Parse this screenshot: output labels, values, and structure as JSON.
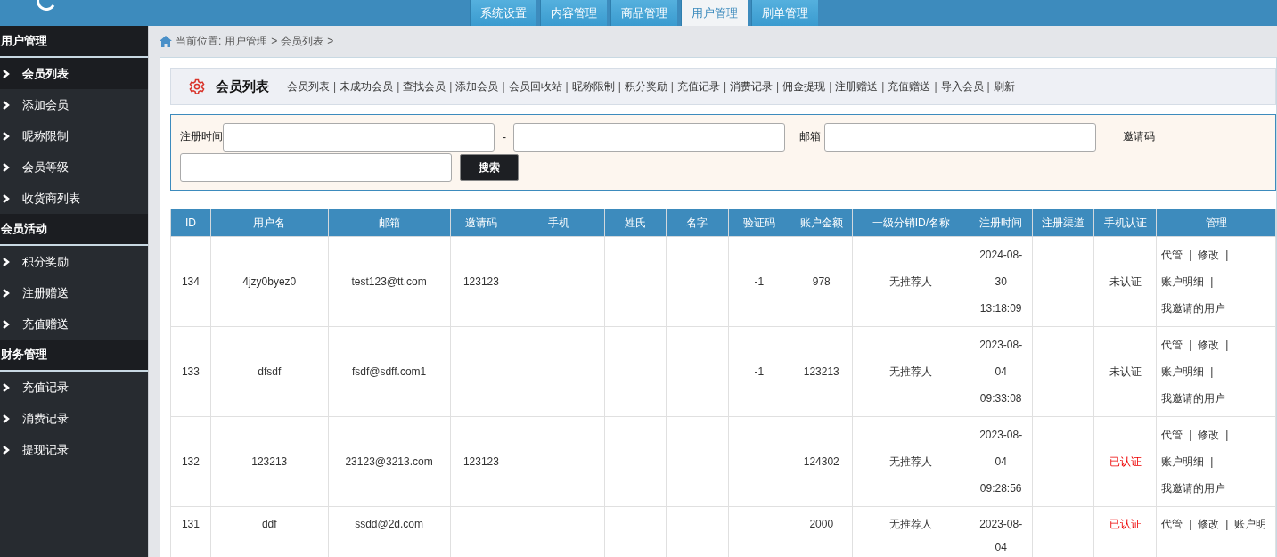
{
  "top_nav": {
    "tabs": [
      {
        "label": "系统设置",
        "selected": false
      },
      {
        "label": "内容管理",
        "selected": false
      },
      {
        "label": "商品管理",
        "selected": false
      },
      {
        "label": "用户管理",
        "selected": true
      },
      {
        "label": "刷单管理",
        "selected": false
      }
    ]
  },
  "sidebar": {
    "groups": [
      {
        "title": "用户管理",
        "items": [
          {
            "label": "会员列表",
            "selected": true
          },
          {
            "label": "添加会员",
            "selected": false
          },
          {
            "label": "昵称限制",
            "selected": false
          },
          {
            "label": "会员等级",
            "selected": false
          },
          {
            "label": "收货商列表",
            "selected": false
          }
        ]
      },
      {
        "title": "会员活动",
        "items": [
          {
            "label": "积分奖励",
            "selected": false
          },
          {
            "label": "注册赠送",
            "selected": false
          },
          {
            "label": "充值赠送",
            "selected": false
          }
        ]
      },
      {
        "title": "财务管理",
        "items": [
          {
            "label": "充值记录",
            "selected": false
          },
          {
            "label": "消费记录",
            "selected": false
          },
          {
            "label": "提现记录",
            "selected": false
          }
        ]
      }
    ]
  },
  "breadcrumb": {
    "label": "当前位置:",
    "items": [
      "用户管理",
      "会员列表"
    ],
    "separator": ">"
  },
  "panel": {
    "title": "会员列表",
    "separator": "|",
    "links": [
      "会员列表",
      "未成功会员",
      "查找会员",
      "添加会员",
      "会员回收站",
      "昵称限制",
      "积分奖励",
      "充值记录",
      "消费记录",
      "佣金提现",
      "注册赠送",
      "充值赠送",
      "导入会员",
      "刷新"
    ]
  },
  "search": {
    "reg_time_label": "注册时间",
    "range_separator": "-",
    "email_label": "邮箱",
    "invite_label": "邀请码",
    "button": "搜索"
  },
  "table": {
    "action_separator": "|",
    "columns": [
      "ID",
      "用户名",
      "邮箱",
      "邀请码",
      "手机",
      "姓氏",
      "名字",
      "验证码",
      "账户金额",
      "一级分销ID/名称",
      "注册时间",
      "注册渠道",
      "手机认证",
      "管理"
    ],
    "rows": [
      {
        "id": "134",
        "username": "4jzy0byez0",
        "email": "test123@tt.com",
        "invite": "123123",
        "phone": "",
        "surname": "",
        "name": "",
        "code": "-1",
        "balance": "978",
        "referrer": "无推荐人",
        "reg_time": "2024-08-30 13:18:09",
        "channel": "",
        "verify": "未认证",
        "verified": false,
        "actions": [
          "代管",
          "修改",
          "账户明细",
          "我邀请的用户"
        ]
      },
      {
        "id": "133",
        "username": "dfsdf",
        "email": "fsdf@sdff.com1",
        "invite": "",
        "phone": "",
        "surname": "",
        "name": "",
        "code": "-1",
        "balance": "123213",
        "referrer": "无推荐人",
        "reg_time": "2023-08-04 09:33:08",
        "channel": "",
        "verify": "未认证",
        "verified": false,
        "actions": [
          "代管",
          "修改",
          "账户明细",
          "我邀请的用户"
        ]
      },
      {
        "id": "132",
        "username": "123213",
        "email": "23123@3213.com",
        "invite": "123123",
        "phone": "",
        "surname": "",
        "name": "",
        "code": "",
        "balance": "124302",
        "referrer": "无推荐人",
        "reg_time": "2023-08-04 09:28:56",
        "channel": "",
        "verify": "已认证",
        "verified": true,
        "actions": [
          "代管",
          "修改",
          "账户明细",
          "我邀请的用户"
        ]
      },
      {
        "id": "131",
        "username": "ddf",
        "email": "ssdd@2d.com",
        "invite": "",
        "phone": "",
        "surname": "",
        "name": "",
        "code": "",
        "balance": "2000",
        "referrer": "无推荐人",
        "reg_time": "2023-08-04",
        "channel": "",
        "verify": "已认证",
        "verified": true,
        "actions": [
          "代管",
          "修改",
          "账户明"
        ]
      }
    ]
  }
}
